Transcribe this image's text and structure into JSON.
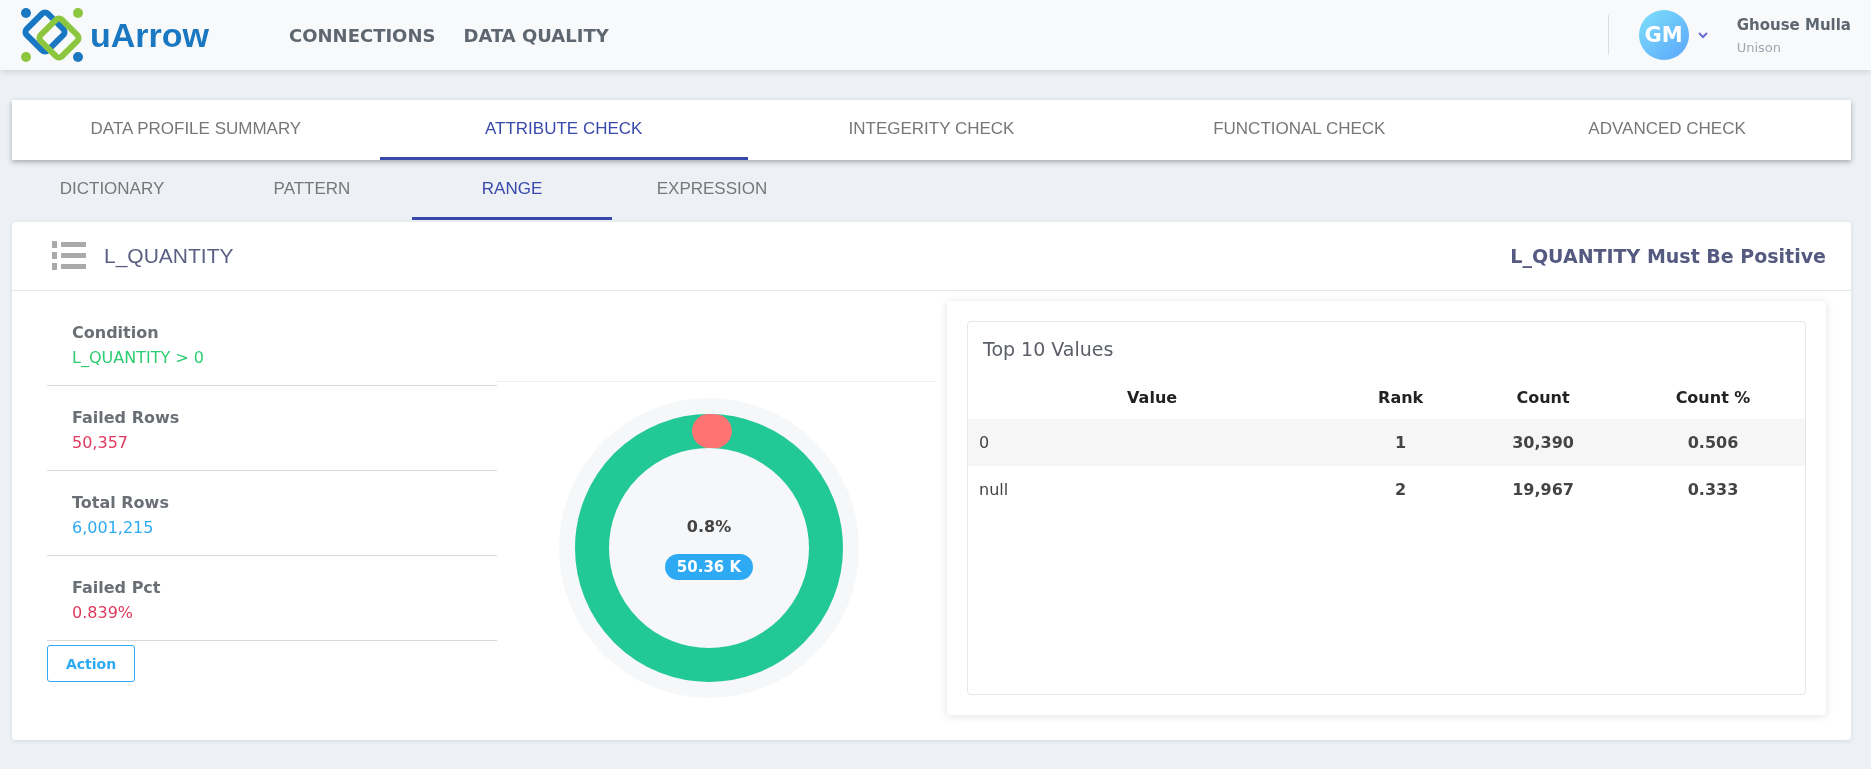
{
  "header": {
    "logo_text": "uArrow",
    "nav": [
      {
        "label": "CONNECTIONS"
      },
      {
        "label": "DATA QUALITY"
      }
    ],
    "user": {
      "initials": "GM",
      "name": "Ghouse Mulla",
      "org": "Unison"
    }
  },
  "tabs": [
    {
      "label": "DATA PROFILE SUMMARY",
      "selected": false
    },
    {
      "label": "ATTRIBUTE CHECK",
      "selected": true
    },
    {
      "label": "INTEGERITY CHECK",
      "selected": false
    },
    {
      "label": "FUNCTIONAL CHECK",
      "selected": false
    },
    {
      "label": "ADVANCED CHECK",
      "selected": false
    }
  ],
  "subtabs": [
    {
      "label": "DICTIONARY",
      "selected": false
    },
    {
      "label": "PATTERN",
      "selected": false
    },
    {
      "label": "RANGE",
      "selected": true
    },
    {
      "label": "EXPRESSION",
      "selected": false
    }
  ],
  "rule": {
    "column": "L_QUANTITY",
    "title": "L_QUANTITY Must Be Positive"
  },
  "stats": [
    {
      "label": "Condition",
      "value": "L_QUANTITY > 0",
      "color": "#2ecc71"
    },
    {
      "label": "Failed Rows",
      "value": "50,357",
      "color": "#e0385e"
    },
    {
      "label": "Total Rows",
      "value": "6,001,215",
      "color": "#2eaaf5"
    },
    {
      "label": "Failed Pct",
      "value": "0.839%",
      "color": "#e0385e"
    }
  ],
  "action_button": "Action",
  "gauge": {
    "level": 0.008,
    "percent": "0.8%",
    "badge": "50.36 K"
  },
  "top_values": {
    "title": "Top 10 Values",
    "columns": [
      "Value",
      "Rank",
      "Count",
      "Count %"
    ],
    "rows": [
      [
        "0",
        "1",
        "30,390",
        "0.506"
      ],
      [
        "null",
        "2",
        "19,967",
        "0.333"
      ]
    ]
  }
}
